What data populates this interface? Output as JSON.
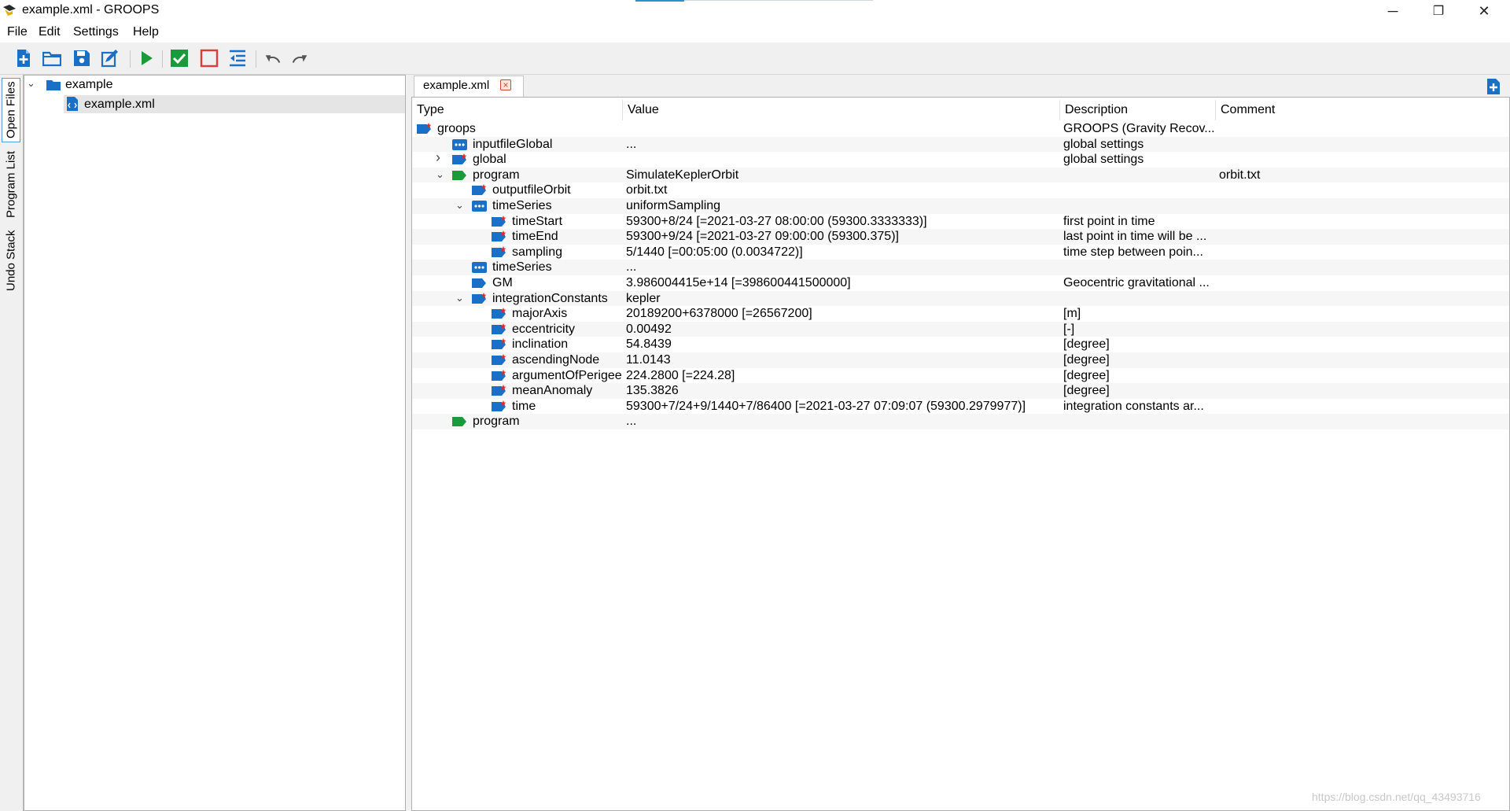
{
  "window": {
    "title": "example.xml - GROOPS",
    "minimize": "─",
    "restore": "❐",
    "close": "✕"
  },
  "menu": [
    "File",
    "Edit",
    "Settings",
    "Help"
  ],
  "toolbar": {
    "icons": [
      "new-file-icon",
      "open-folder-icon",
      "save-icon",
      "edit-icon",
      "run-icon",
      "check-icon",
      "stop-icon",
      "indent-icon",
      "undo-icon",
      "redo-icon"
    ]
  },
  "side_tabs": [
    "Open Files",
    "Program List",
    "Undo Stack"
  ],
  "file_tree": {
    "folder": "example",
    "file": "example.xml"
  },
  "document_tab": {
    "label": "example.xml"
  },
  "columns": {
    "type": "Type",
    "value": "Value",
    "description": "Description",
    "comment": "Comment"
  },
  "rows": [
    {
      "type": "groops",
      "value": "",
      "description": "GROOPS (Gravity Recov...",
      "comment": ""
    },
    {
      "type": "inputfileGlobal",
      "value": "...",
      "description": "global settings",
      "comment": ""
    },
    {
      "type": "global",
      "value": "",
      "description": "global settings",
      "comment": ""
    },
    {
      "type": "program",
      "value": "SimulateKeplerOrbit",
      "description": "",
      "comment": "orbit.txt"
    },
    {
      "type": "outputfileOrbit",
      "value": "orbit.txt",
      "description": "",
      "comment": ""
    },
    {
      "type": "timeSeries",
      "value": "uniformSampling",
      "description": "",
      "comment": ""
    },
    {
      "type": "timeStart",
      "value": "59300+8/24   [=2021-03-27 08:00:00 (59300.3333333)]",
      "description": "first point in time",
      "comment": ""
    },
    {
      "type": "timeEnd",
      "value": "59300+9/24   [=2021-03-27 09:00:00 (59300.375)]",
      "description": "last point in time will be ...",
      "comment": ""
    },
    {
      "type": "sampling",
      "value": "5/1440   [=00:05:00 (0.0034722)]",
      "description": "time step between poin...",
      "comment": ""
    },
    {
      "type": "timeSeries",
      "value": "...",
      "description": "",
      "comment": ""
    },
    {
      "type": "GM",
      "value": "3.986004415e+14   [=398600441500000]",
      "description": "Geocentric gravitational ...",
      "comment": ""
    },
    {
      "type": "integrationConstants",
      "value": "kepler",
      "description": "",
      "comment": ""
    },
    {
      "type": "majorAxis",
      "value": "20189200+6378000   [=26567200]",
      "description": "[m]",
      "comment": ""
    },
    {
      "type": "eccentricity",
      "value": "0.00492",
      "description": "[-]",
      "comment": ""
    },
    {
      "type": "inclination",
      "value": "54.8439",
      "description": "[degree]",
      "comment": ""
    },
    {
      "type": "ascendingNode",
      "value": "11.0143",
      "description": "[degree]",
      "comment": ""
    },
    {
      "type": "argumentOfPerigee",
      "value": "224.2800   [=224.28]",
      "description": "[degree]",
      "comment": ""
    },
    {
      "type": "meanAnomaly",
      "value": "135.3826",
      "description": "[degree]",
      "comment": ""
    },
    {
      "type": "time",
      "value": "59300+7/24+9/1440+7/86400   [=2021-03-27 07:09:07 (59300.2979977)]",
      "description": "integration constants ar...",
      "comment": ""
    },
    {
      "type": "program",
      "value": "...",
      "description": "",
      "comment": ""
    }
  ],
  "watermark": "https://blog.csdn.net/qq_43493716",
  "colors": {
    "icon_blue": "#1a6fc6",
    "icon_green": "#1a9a3a",
    "selection": "#e5e5e5"
  }
}
